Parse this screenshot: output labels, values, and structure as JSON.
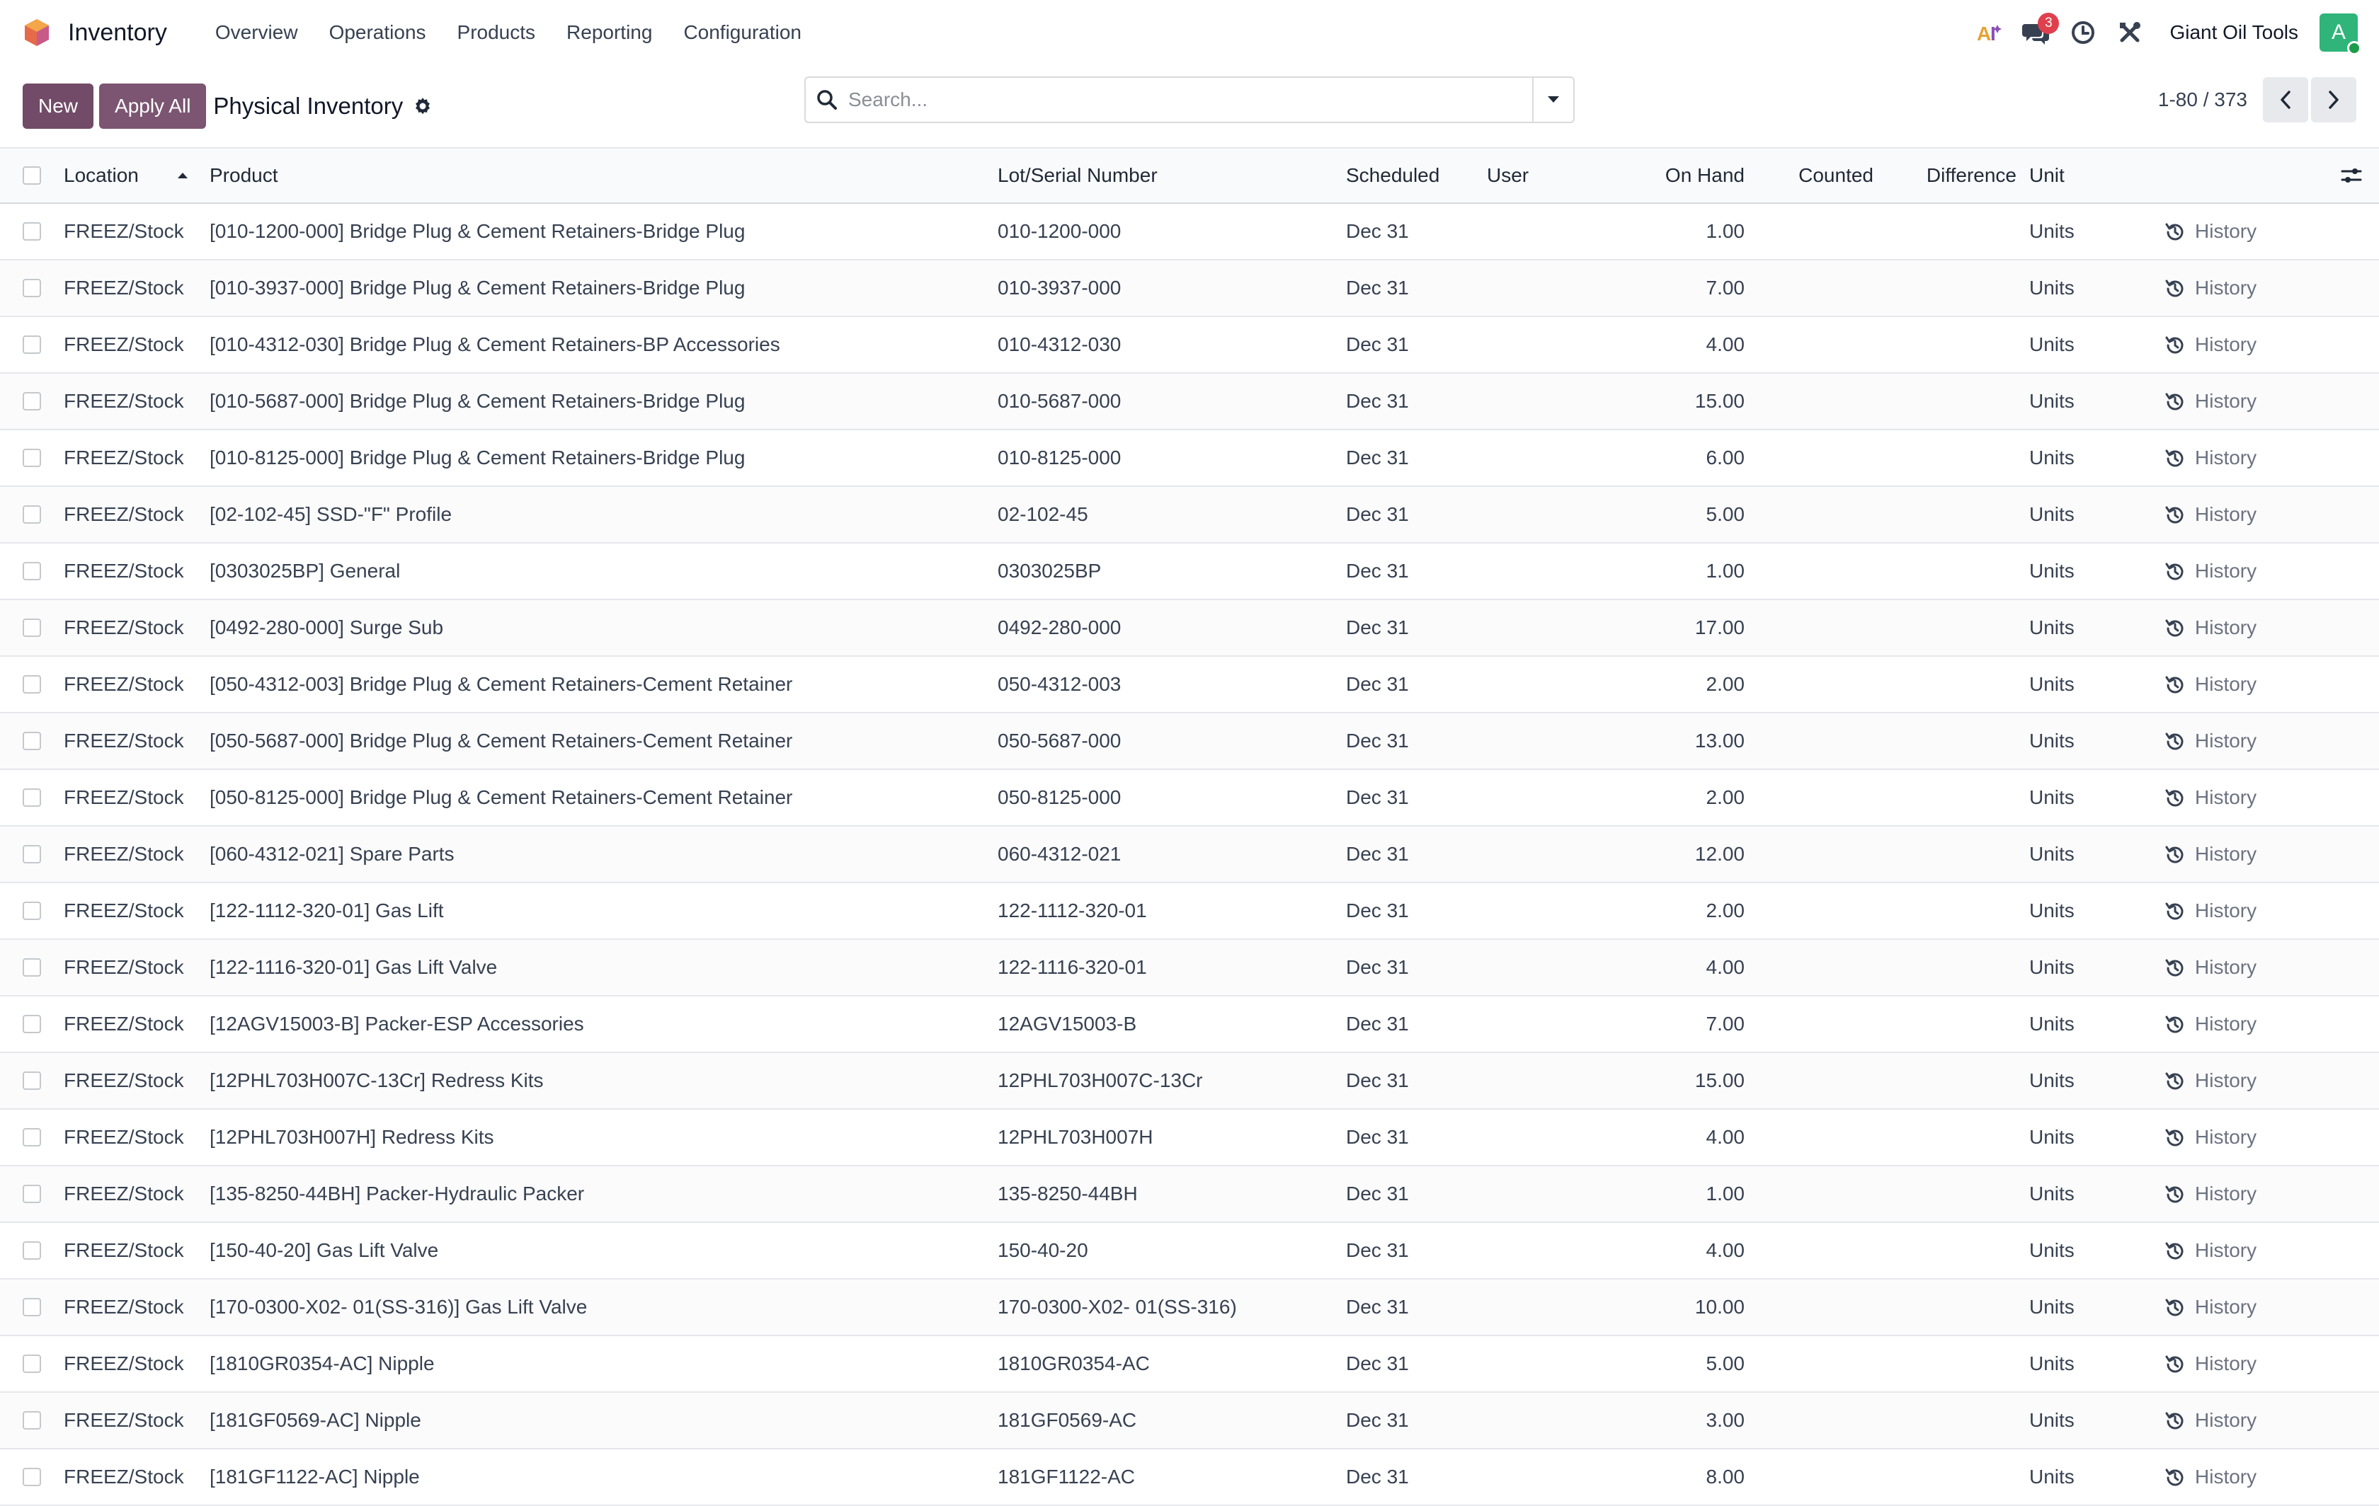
{
  "nav": {
    "app_name": "Inventory",
    "menu": [
      "Overview",
      "Operations",
      "Products",
      "Reporting",
      "Configuration"
    ],
    "messages_count": "3",
    "company": "Giant Oil Tools",
    "avatar_initial": "A"
  },
  "control": {
    "new_label": "New",
    "apply_all_label": "Apply All",
    "title": "Physical Inventory",
    "search_placeholder": "Search...",
    "pager": "1-80 / 373"
  },
  "table": {
    "headers": {
      "location": "Location",
      "product": "Product",
      "lot": "Lot/Serial Number",
      "scheduled": "Scheduled",
      "user": "User",
      "on_hand": "On Hand",
      "counted": "Counted",
      "difference": "Difference",
      "unit": "Unit"
    },
    "history_label": "History",
    "rows": [
      {
        "location": "FREEZ/Stock",
        "product": "[010-1200-000] Bridge Plug & Cement Retainers-Bridge Plug",
        "lot": "010-1200-000",
        "scheduled": "Dec 31",
        "user": "",
        "on_hand": "1.00",
        "counted": "",
        "difference": "",
        "unit": "Units"
      },
      {
        "location": "FREEZ/Stock",
        "product": "[010-3937-000] Bridge Plug & Cement Retainers-Bridge Plug",
        "lot": "010-3937-000",
        "scheduled": "Dec 31",
        "user": "",
        "on_hand": "7.00",
        "counted": "",
        "difference": "",
        "unit": "Units"
      },
      {
        "location": "FREEZ/Stock",
        "product": "[010-4312-030] Bridge Plug & Cement Retainers-BP Accessories",
        "lot": "010-4312-030",
        "scheduled": "Dec 31",
        "user": "",
        "on_hand": "4.00",
        "counted": "",
        "difference": "",
        "unit": "Units"
      },
      {
        "location": "FREEZ/Stock",
        "product": "[010-5687-000] Bridge Plug & Cement Retainers-Bridge Plug",
        "lot": "010-5687-000",
        "scheduled": "Dec 31",
        "user": "",
        "on_hand": "15.00",
        "counted": "",
        "difference": "",
        "unit": "Units"
      },
      {
        "location": "FREEZ/Stock",
        "product": "[010-8125-000] Bridge Plug & Cement Retainers-Bridge Plug",
        "lot": "010-8125-000",
        "scheduled": "Dec 31",
        "user": "",
        "on_hand": "6.00",
        "counted": "",
        "difference": "",
        "unit": "Units"
      },
      {
        "location": "FREEZ/Stock",
        "product": "[02-102-45] SSD-\"F\" Profile",
        "lot": "02-102-45",
        "scheduled": "Dec 31",
        "user": "",
        "on_hand": "5.00",
        "counted": "",
        "difference": "",
        "unit": "Units"
      },
      {
        "location": "FREEZ/Stock",
        "product": "[0303025BP] General",
        "lot": "0303025BP",
        "scheduled": "Dec 31",
        "user": "",
        "on_hand": "1.00",
        "counted": "",
        "difference": "",
        "unit": "Units"
      },
      {
        "location": "FREEZ/Stock",
        "product": "[0492-280-000] Surge Sub",
        "lot": "0492-280-000",
        "scheduled": "Dec 31",
        "user": "",
        "on_hand": "17.00",
        "counted": "",
        "difference": "",
        "unit": "Units"
      },
      {
        "location": "FREEZ/Stock",
        "product": "[050-4312-003] Bridge Plug & Cement Retainers-Cement Retainer",
        "lot": "050-4312-003",
        "scheduled": "Dec 31",
        "user": "",
        "on_hand": "2.00",
        "counted": "",
        "difference": "",
        "unit": "Units"
      },
      {
        "location": "FREEZ/Stock",
        "product": "[050-5687-000] Bridge Plug & Cement Retainers-Cement Retainer",
        "lot": "050-5687-000",
        "scheduled": "Dec 31",
        "user": "",
        "on_hand": "13.00",
        "counted": "",
        "difference": "",
        "unit": "Units"
      },
      {
        "location": "FREEZ/Stock",
        "product": "[050-8125-000] Bridge Plug & Cement Retainers-Cement Retainer",
        "lot": "050-8125-000",
        "scheduled": "Dec 31",
        "user": "",
        "on_hand": "2.00",
        "counted": "",
        "difference": "",
        "unit": "Units"
      },
      {
        "location": "FREEZ/Stock",
        "product": "[060-4312-021] Spare Parts",
        "lot": "060-4312-021",
        "scheduled": "Dec 31",
        "user": "",
        "on_hand": "12.00",
        "counted": "",
        "difference": "",
        "unit": "Units"
      },
      {
        "location": "FREEZ/Stock",
        "product": "[122-1112-320-01] Gas Lift",
        "lot": "122-1112-320-01",
        "scheduled": "Dec 31",
        "user": "",
        "on_hand": "2.00",
        "counted": "",
        "difference": "",
        "unit": "Units"
      },
      {
        "location": "FREEZ/Stock",
        "product": "[122-1116-320-01] Gas Lift Valve",
        "lot": "122-1116-320-01",
        "scheduled": "Dec 31",
        "user": "",
        "on_hand": "4.00",
        "counted": "",
        "difference": "",
        "unit": "Units"
      },
      {
        "location": "FREEZ/Stock",
        "product": "[12AGV15003-B] Packer-ESP Accessories",
        "lot": "12AGV15003-B",
        "scheduled": "Dec 31",
        "user": "",
        "on_hand": "7.00",
        "counted": "",
        "difference": "",
        "unit": "Units"
      },
      {
        "location": "FREEZ/Stock",
        "product": "[12PHL703H007C-13Cr] Redress Kits",
        "lot": "12PHL703H007C-13Cr",
        "scheduled": "Dec 31",
        "user": "",
        "on_hand": "15.00",
        "counted": "",
        "difference": "",
        "unit": "Units"
      },
      {
        "location": "FREEZ/Stock",
        "product": "[12PHL703H007H] Redress Kits",
        "lot": "12PHL703H007H",
        "scheduled": "Dec 31",
        "user": "",
        "on_hand": "4.00",
        "counted": "",
        "difference": "",
        "unit": "Units"
      },
      {
        "location": "FREEZ/Stock",
        "product": "[135-8250-44BH] Packer-Hydraulic Packer",
        "lot": "135-8250-44BH",
        "scheduled": "Dec 31",
        "user": "",
        "on_hand": "1.00",
        "counted": "",
        "difference": "",
        "unit": "Units"
      },
      {
        "location": "FREEZ/Stock",
        "product": "[150-40-20] Gas Lift Valve",
        "lot": "150-40-20",
        "scheduled": "Dec 31",
        "user": "",
        "on_hand": "4.00",
        "counted": "",
        "difference": "",
        "unit": "Units"
      },
      {
        "location": "FREEZ/Stock",
        "product": "[170-0300-X02- 01(SS-316)] Gas Lift Valve",
        "lot": "170-0300-X02- 01(SS-316)",
        "scheduled": "Dec 31",
        "user": "",
        "on_hand": "10.00",
        "counted": "",
        "difference": "",
        "unit": "Units"
      },
      {
        "location": "FREEZ/Stock",
        "product": "[1810GR0354-AC] Nipple",
        "lot": "1810GR0354-AC",
        "scheduled": "Dec 31",
        "user": "",
        "on_hand": "5.00",
        "counted": "",
        "difference": "",
        "unit": "Units"
      },
      {
        "location": "FREEZ/Stock",
        "product": "[181GF0569-AC] Nipple",
        "lot": "181GF0569-AC",
        "scheduled": "Dec 31",
        "user": "",
        "on_hand": "3.00",
        "counted": "",
        "difference": "",
        "unit": "Units"
      },
      {
        "location": "FREEZ/Stock",
        "product": "[181GF1122-AC] Nipple",
        "lot": "181GF1122-AC",
        "scheduled": "Dec 31",
        "user": "",
        "on_hand": "8.00",
        "counted": "",
        "difference": "",
        "unit": "Units"
      }
    ]
  },
  "colors": {
    "brand": "#714b67",
    "badge": "#e0404d",
    "avatar": "#2fb57a"
  }
}
